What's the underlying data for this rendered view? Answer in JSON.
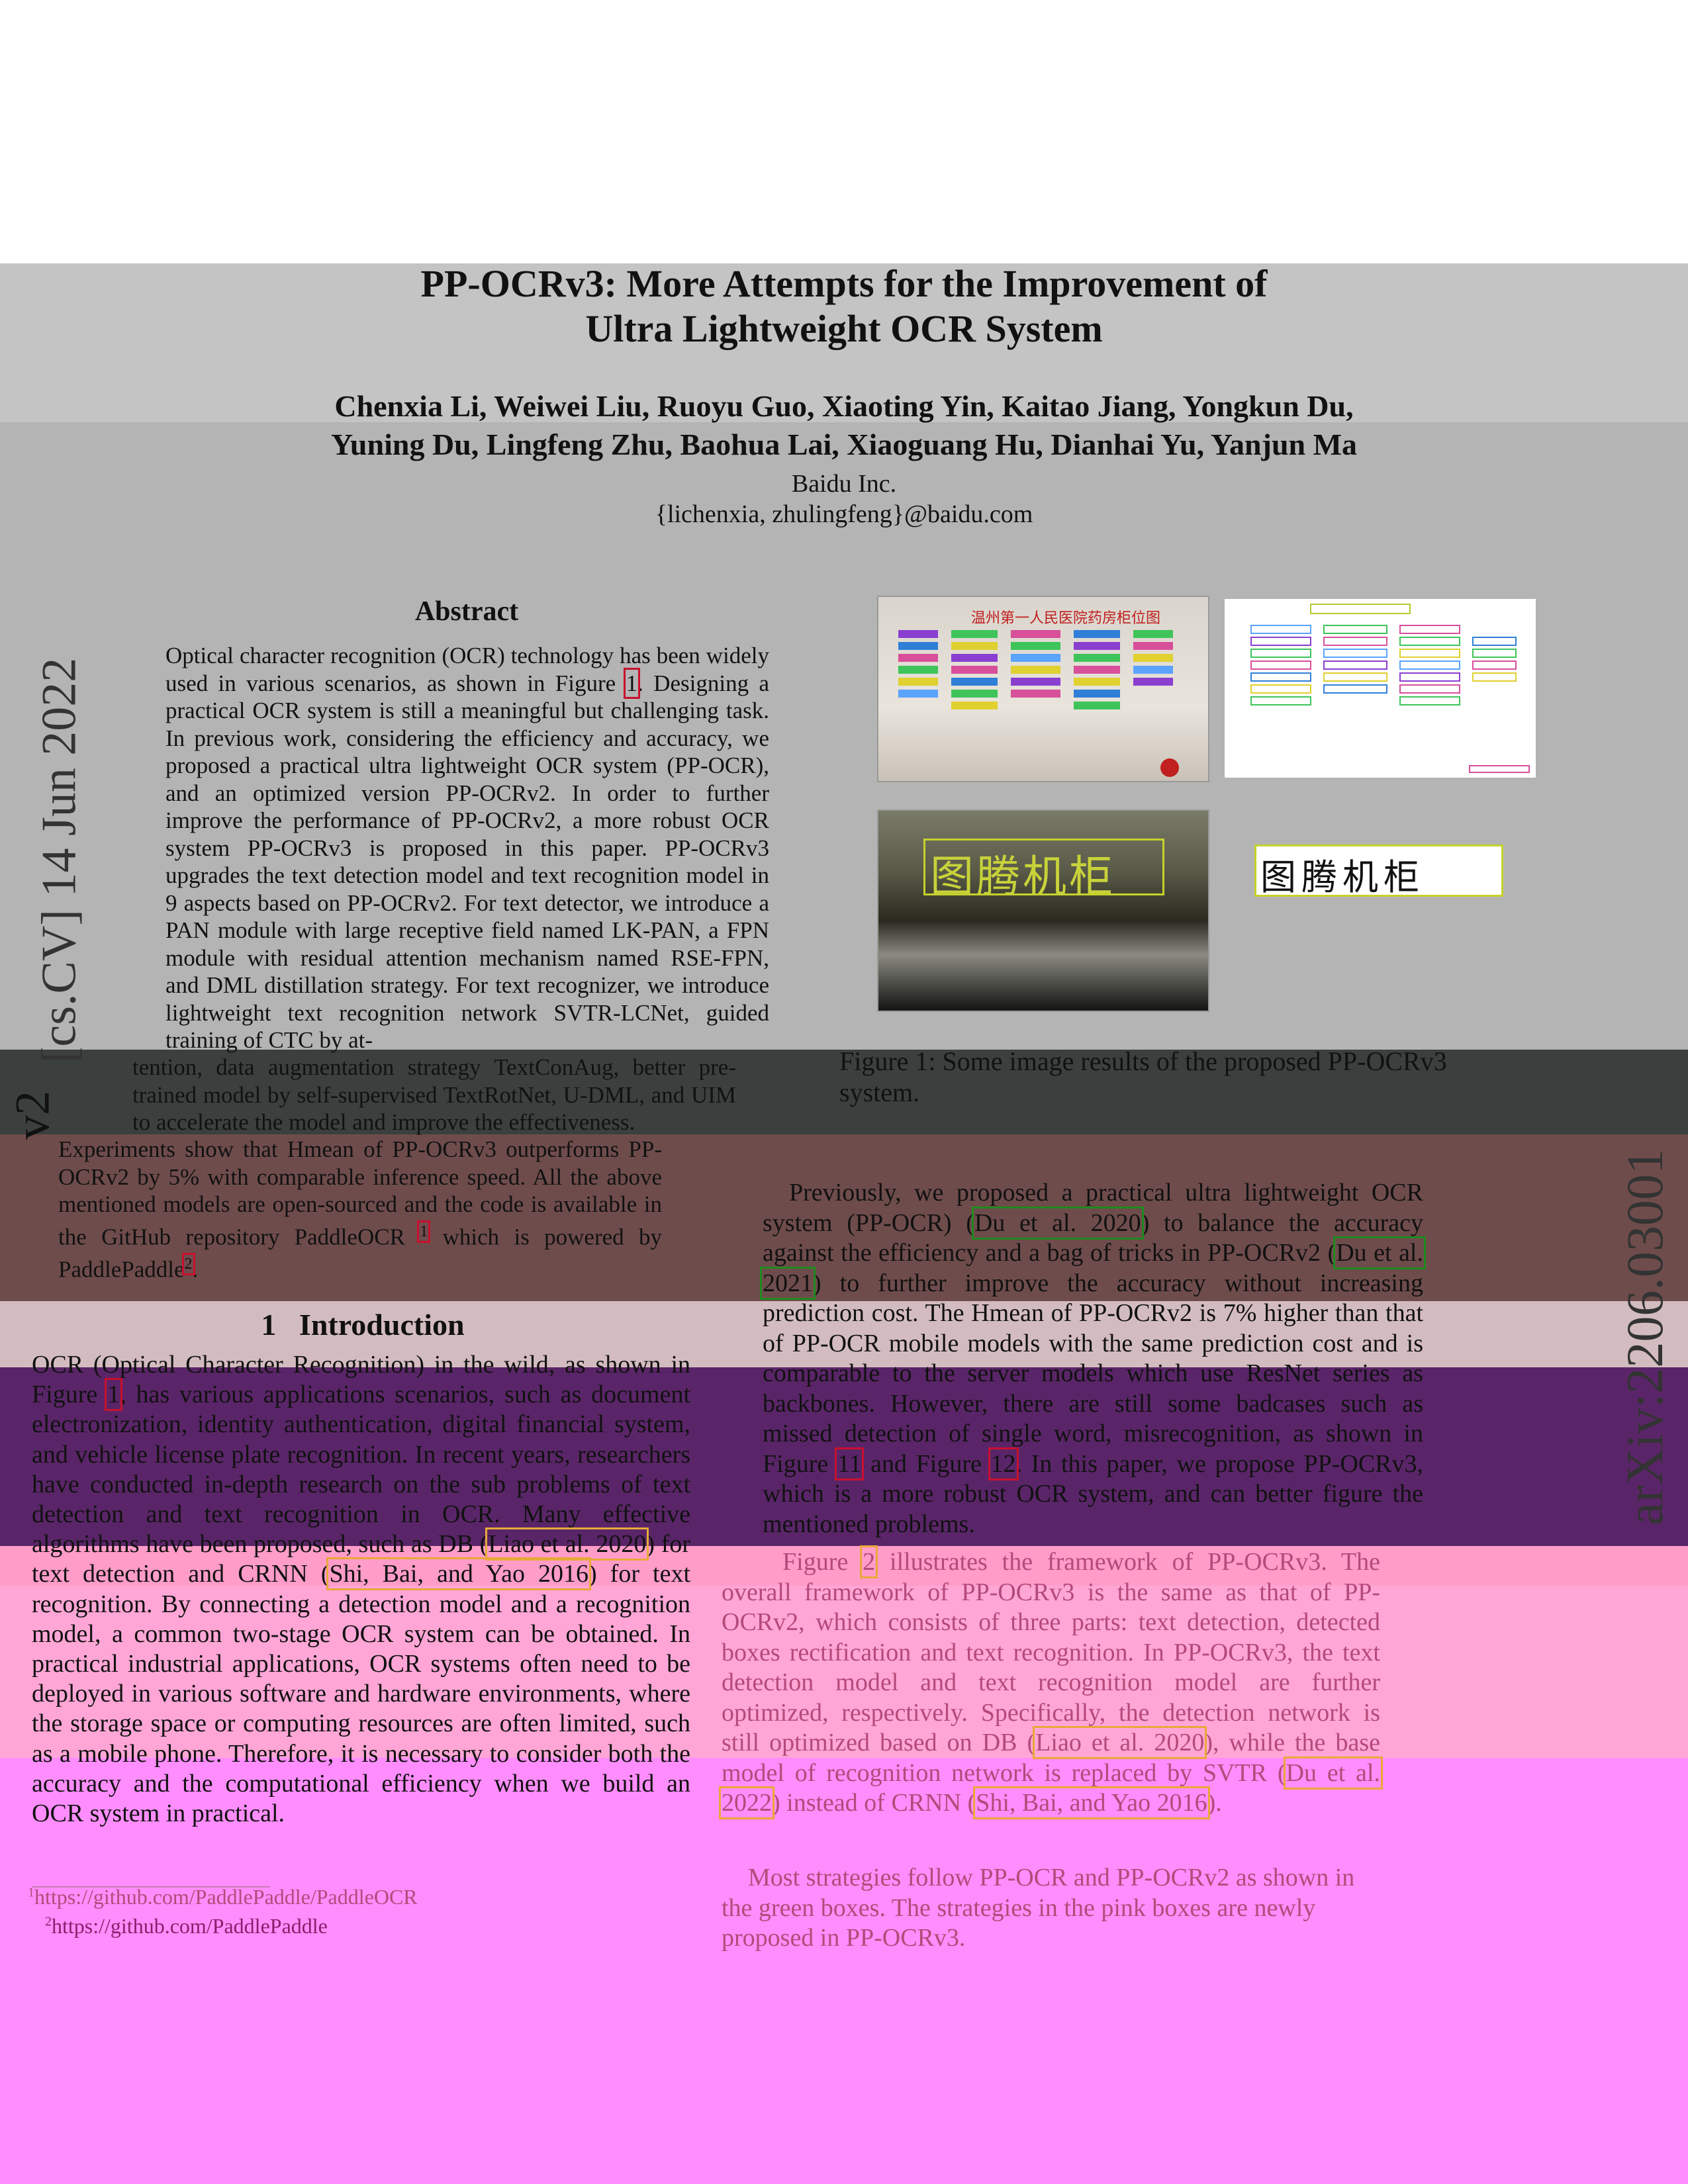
{
  "paper": {
    "title_line1": "PP-OCRv3: More Attempts for the Improvement of",
    "title_line2": "Ultra Lightweight OCR System",
    "authors_line1": "Chenxia Li, Weiwei Liu, Ruoyu Guo, Xiaoting Yin, Kaitao Jiang, Yongkun Du,",
    "authors_line2": "Yuning Du, Lingfeng Zhu, Baohua Lai, Xiaoguang Hu, Dianhai Yu, Yanjun Ma",
    "affiliation": "Baidu Inc.",
    "email": "{lichenxia, zhulingfeng}@baidu.com",
    "arxiv_side": "[cs.CV]  14 Jun 2022",
    "arxiv_v": "v2",
    "arxiv_id": "arXiv:2206.03001"
  },
  "abstract": {
    "heading": "Abstract",
    "p1": "Optical character recognition (OCR) technology has been widely used in various scenarios, as shown in Figure",
    "ref1": "1",
    "p1b": ". Designing a practical OCR system is still a meaningful but challenging task. In previous work, considering the efficiency and accuracy, we proposed a practical ultra lightweight OCR system (PP-OCR), and an optimized version PP-OCRv2. In order to further improve the performance of PP-OCRv2, a more robust OCR system PP-OCRv3 is proposed in this paper. PP-OCRv3 upgrades the text detection model and text recognition model in 9 aspects based on PP-OCRv2. For text detector, we introduce a PAN module with large receptive field named LK-PAN, a FPN module with residual attention mechanism named RSE-FPN, and DML distillation strategy. For text recognizer, we introduce lightweight text recognition network SVTR-LCNet, guided training of CTC by at-",
    "p2": "tention, data augmentation strategy TextConAug, better pre-trained model by self-supervised TextRotNet, U-DML, and UIM to accelerate the model and improve the effectiveness.",
    "p3": "Experiments show that Hmean of PP-OCRv3 outperforms PP-OCRv2 by 5% with comparable inference speed. All the above mentioned models are open-sourced and the code is available in the GitHub repository PaddleOCR",
    "fn1": "1",
    "p3b": " which is powered by PaddlePaddle",
    "fn2": "2",
    "p3c": "."
  },
  "figure1": {
    "caption": "Figure 1: Some image results of the proposed PP-OCRv3 system.",
    "board_title": "温州第一人民医院药房柜位图",
    "cabinet_text": "图腾机柜"
  },
  "intro": {
    "heading_num": "1",
    "heading": "Introduction",
    "p1a": "OCR (Optical Character Recognition) in the wild, as shown in Figure",
    "ref1": "1",
    "p1b": ", has various applications scenarios, such as document electronization, identity authentication, digital financial system, and vehicle license plate recognition. In recent years, researchers have conducted in-depth research on the sub problems of text detection and text recognition in OCR. Many effective algorithms have been proposed, such as DB (",
    "cite_liao": "Liao et al. 2020",
    "p1c": ") for text detection and CRNN (",
    "cite_shi": "Shi, Bai, and Yao 2016",
    "p1d": ") for text recognition. By connecting a detection model and a recognition model, a common two-stage OCR system can be obtained. In practical industrial applications, OCR systems often need to be deployed in various software and hardware environments, where the storage space or computing resources are often limited, such as a mobile phone. Therefore, it is necessary to consider both the accuracy and the computational efficiency when we build an OCR system in practical.",
    "footnote1": "https://github.com/PaddlePaddle/PaddleOCR",
    "footnote2": "https://github.com/PaddlePaddle"
  },
  "right": {
    "p1a": "Previously, we proposed a practical ultra lightweight OCR system (PP-OCR) (",
    "cite_du20": "Du et al. 2020",
    "p1b": ") to balance the accuracy against the efficiency and a bag of tricks in PP-OCRv2 (",
    "cite_du21": "Du et al. 2021",
    "p1c": ") to further improve the accuracy without increasing prediction cost. The Hmean of PP-OCRv2 is 7% higher than that of PP-OCR mobile models with the same prediction cost and is comparable to the server models which use ResNet series as backbones. However, there are still some badcases such as missed detection of single word, misrecognition, as shown in Figure",
    "ref11": "11",
    "p1d": " and Figure",
    "ref12": "12",
    "p1e": ". In this paper, we propose PP-OCRv3, which is a more robust OCR system, and can better figure the mentioned problems.",
    "p2a": "Figure",
    "ref2": "2",
    "p2b": " illustrates the framework of PP-OCRv3. The overall framework of PP-OCRv3 is the same as that of PP-OCRv2, which consists of three parts: text detection, detected boxes rectification and text recognition. In PP-OCRv3, the text detection model and text recognition model are further optimized, respectively. Specifically, the detection network is still optimized based on DB (",
    "cite_liao": "Liao et al. 2020",
    "p2c": "), while the base model of recognition network is replaced by SVTR (",
    "cite_du22": "Du et al. 2022",
    "p2d": ") instead of CRNN (",
    "cite_shi": "Shi, Bai, and Yao 2016",
    "p2e": ").",
    "p3": "Most strategies follow PP-OCR and PP-OCRv2 as shown in the green boxes. The strategies in the pink boxes are newly proposed in PP-OCRv3."
  },
  "colors": {
    "band_gray": "#bdbdbd",
    "band_dark": "#3a3f3d",
    "band_maroon": "#6e4b4b",
    "band_purple": "#5b2468",
    "band_pink": "#ff8fff",
    "cite_green": "#1e8a1e",
    "cite_red": "#c8102e",
    "cite_yellow": "#e8a93a"
  }
}
